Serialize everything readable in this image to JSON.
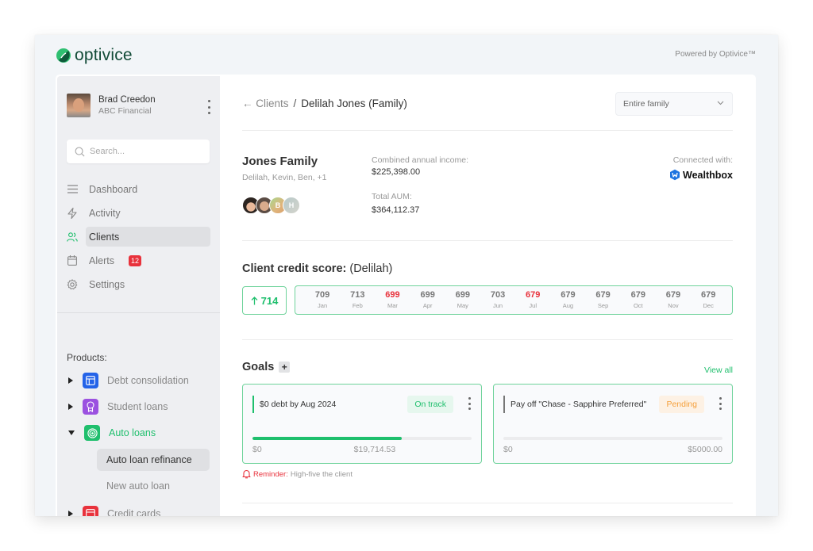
{
  "app": {
    "brand": "optivice",
    "powered_by": "Powered by Optivice™",
    "accent_color": "#1fbf6d",
    "alert_color": "#e8323c"
  },
  "sidebar": {
    "user": {
      "name": "Brad Creedon",
      "org": "ABC Financial"
    },
    "search": {
      "placeholder": "Search..."
    },
    "nav": [
      {
        "label": "Dashboard",
        "icon": "menu-icon"
      },
      {
        "label": "Activity",
        "icon": "lightning-icon"
      },
      {
        "label": "Clients",
        "icon": "users-icon",
        "active": true
      },
      {
        "label": "Alerts",
        "icon": "calendar-icon",
        "badge": "12"
      },
      {
        "label": "Settings",
        "icon": "gear-icon"
      }
    ],
    "products_title": "Products:",
    "products": [
      {
        "label": "Debt consolidation",
        "icon": "layout-icon",
        "color": "#2463e8",
        "expanded": false
      },
      {
        "label": "Student loans",
        "icon": "award-icon",
        "color": "#9b51e0",
        "expanded": false
      },
      {
        "label": "Auto loans",
        "icon": "target-icon",
        "color": "#1fbf6d",
        "expanded": true,
        "children": [
          {
            "label": "Auto loan refinance",
            "active": true
          },
          {
            "label": "New auto loan"
          }
        ]
      },
      {
        "label": "Credit cards",
        "icon": "credit-card-icon",
        "color": "#e8323c",
        "expanded": false
      }
    ]
  },
  "main": {
    "breadcrumb": {
      "back": "← Clients",
      "separator": "/",
      "current": "Delilah Jones (Family)"
    },
    "scope_select": {
      "value": "Entire family"
    },
    "family": {
      "name": "Jones Family",
      "members": "Delilah, Kevin, Ben, +1",
      "avatars": [
        "",
        "",
        "B",
        "H"
      ],
      "income_label": "Combined annual income:",
      "income_value": "$225,398.00",
      "aum_label": "Total AUM:",
      "aum_value": "$364,112.37",
      "connected_label": "Connected with:",
      "connected_service": "Wealthbox"
    },
    "credit": {
      "title_bold": "Client credit score:",
      "title_rest": " (Delilah)",
      "current": "714",
      "trend": "up",
      "months": [
        {
          "m": "Jan",
          "v": "709",
          "drop": false
        },
        {
          "m": "Feb",
          "v": "713",
          "drop": false
        },
        {
          "m": "Mar",
          "v": "699",
          "drop": true
        },
        {
          "m": "Apr",
          "v": "699",
          "drop": false
        },
        {
          "m": "May",
          "v": "699",
          "drop": false
        },
        {
          "m": "Jun",
          "v": "703",
          "drop": false
        },
        {
          "m": "Jul",
          "v": "679",
          "drop": true
        },
        {
          "m": "Aug",
          "v": "679",
          "drop": false
        },
        {
          "m": "Sep",
          "v": "679",
          "drop": false
        },
        {
          "m": "Oct",
          "v": "679",
          "drop": false
        },
        {
          "m": "Nov",
          "v": "679",
          "drop": false
        },
        {
          "m": "Dec",
          "v": "679",
          "drop": false
        }
      ]
    },
    "goals": {
      "title": "Goals",
      "add_label": "+",
      "view_all": "View all",
      "items": [
        {
          "title": "$0 debt by Aug 2024",
          "status": "On track",
          "status_color": "#1fbf6d",
          "status_bg": "#e6f7ee",
          "bar_color": "#1fbf6d",
          "min": "$0",
          "max": "$19,714.53",
          "progress": 0.68
        },
        {
          "title": "Pay off \"Chase - Sapphire Preferred\"",
          "status": "Pending",
          "status_color": "#f5a03c",
          "status_bg": "#fdf1e4",
          "bar_color": "#777777",
          "min": "$0",
          "max": "$5000.00",
          "progress": 0
        }
      ],
      "reminder_label": "Reminder:",
      "reminder_text": " High-five the client"
    }
  }
}
